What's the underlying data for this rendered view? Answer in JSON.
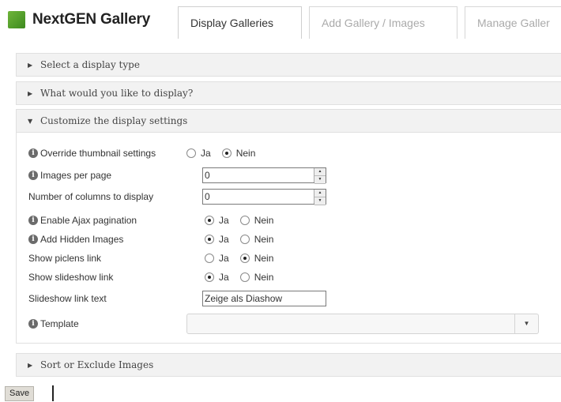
{
  "header": {
    "logo_text": "NextGEN Gallery",
    "tabs": [
      {
        "label": "Display Galleries",
        "active": true
      },
      {
        "label": "Add Gallery / Images",
        "active": false
      },
      {
        "label": "Manage Galler",
        "active": false
      }
    ]
  },
  "sections": [
    {
      "label": "Select a display type",
      "expanded": false
    },
    {
      "label": "What would you like to display?",
      "expanded": false
    },
    {
      "label": "Customize the display settings",
      "expanded": true
    },
    {
      "label": "Sort or Exclude Images",
      "expanded": false
    }
  ],
  "settings": {
    "override_thumbnail": {
      "label": "Override thumbnail settings",
      "options": [
        "Ja",
        "Nein"
      ],
      "selected": "Nein"
    },
    "images_per_page": {
      "label": "Images per page",
      "value": "0"
    },
    "num_columns": {
      "label": "Number of columns to display",
      "value": "0"
    },
    "ajax_pagination": {
      "label": "Enable Ajax pagination",
      "options": [
        "Ja",
        "Nein"
      ],
      "selected": "Ja"
    },
    "hidden_images": {
      "label": "Add Hidden Images",
      "options": [
        "Ja",
        "Nein"
      ],
      "selected": "Ja"
    },
    "piclens_link": {
      "label": "Show piclens link",
      "options": [
        "Ja",
        "Nein"
      ],
      "selected": "Nein"
    },
    "slideshow_link": {
      "label": "Show slideshow link",
      "options": [
        "Ja",
        "Nein"
      ],
      "selected": "Ja"
    },
    "slideshow_text": {
      "label": "Slideshow link text",
      "value": "Zeige als Diashow"
    },
    "template": {
      "label": "Template",
      "value": ""
    }
  },
  "footer": {
    "save_label": "Save"
  },
  "colors": {
    "logo_green": "#4f9d2a",
    "accordion_bg": "#f2f2f2"
  }
}
